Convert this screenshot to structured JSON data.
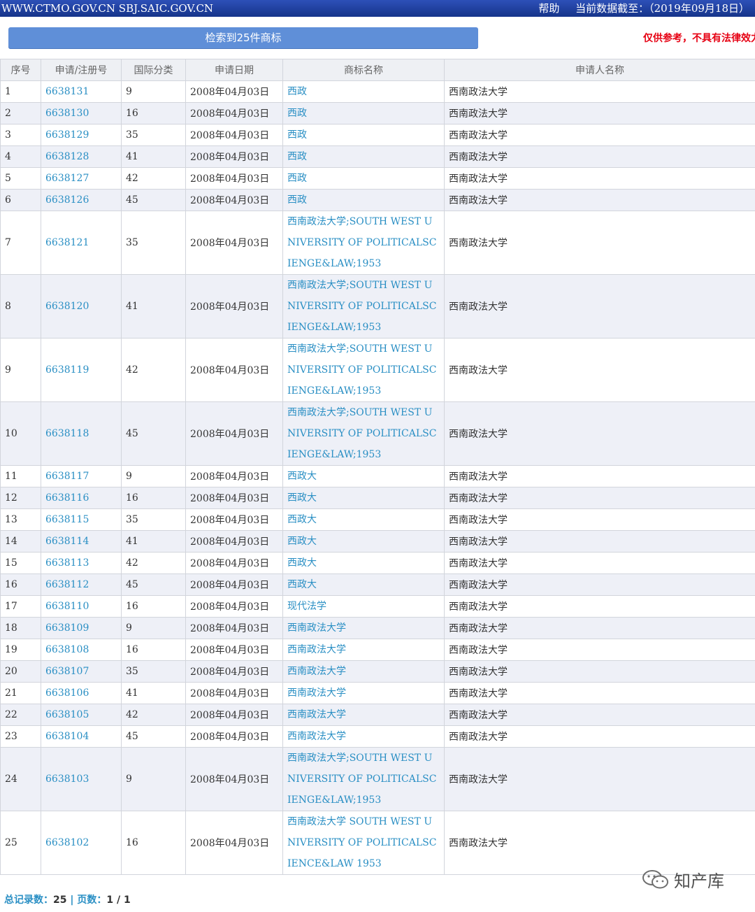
{
  "header": {
    "site": "WWW.CTMO.GOV.CN SBJ.SAIC.GOV.CN",
    "help": "帮助",
    "data_as_of": "当前数据截至：（2019年09月18日）"
  },
  "result_button": "检索到25件商标",
  "disclaimer": "仅供参考，不具有法律效力",
  "columns": [
    "序号",
    "申请/注册号",
    "国际分类",
    "申请日期",
    "商标名称",
    "申请人名称"
  ],
  "rows": [
    {
      "seq": "1",
      "reg": "6638131",
      "cls": "9",
      "date": "2008年04月03日",
      "name": "西政",
      "applicant": "西南政法大学"
    },
    {
      "seq": "2",
      "reg": "6638130",
      "cls": "16",
      "date": "2008年04月03日",
      "name": "西政",
      "applicant": "西南政法大学"
    },
    {
      "seq": "3",
      "reg": "6638129",
      "cls": "35",
      "date": "2008年04月03日",
      "name": "西政",
      "applicant": "西南政法大学"
    },
    {
      "seq": "4",
      "reg": "6638128",
      "cls": "41",
      "date": "2008年04月03日",
      "name": "西政",
      "applicant": "西南政法大学"
    },
    {
      "seq": "5",
      "reg": "6638127",
      "cls": "42",
      "date": "2008年04月03日",
      "name": "西政",
      "applicant": "西南政法大学"
    },
    {
      "seq": "6",
      "reg": "6638126",
      "cls": "45",
      "date": "2008年04月03日",
      "name": "西政",
      "applicant": "西南政法大学"
    },
    {
      "seq": "7",
      "reg": "6638121",
      "cls": "35",
      "date": "2008年04月03日",
      "name": "西南政法大学;SOUTH WEST UNIVERSITY OF POLITICALSCIENGE&LAW;1953",
      "applicant": "西南政法大学"
    },
    {
      "seq": "8",
      "reg": "6638120",
      "cls": "41",
      "date": "2008年04月03日",
      "name": "西南政法大学;SOUTH WEST UNIVERSITY OF POLITICALSCIENGE&LAW;1953",
      "applicant": "西南政法大学"
    },
    {
      "seq": "9",
      "reg": "6638119",
      "cls": "42",
      "date": "2008年04月03日",
      "name": "西南政法大学;SOUTH WEST UNIVERSITY OF POLITICALSCIENGE&LAW;1953",
      "applicant": "西南政法大学"
    },
    {
      "seq": "10",
      "reg": "6638118",
      "cls": "45",
      "date": "2008年04月03日",
      "name": "西南政法大学;SOUTH WEST UNIVERSITY OF POLITICALSCIENGE&LAW;1953",
      "applicant": "西南政法大学"
    },
    {
      "seq": "11",
      "reg": "6638117",
      "cls": "9",
      "date": "2008年04月03日",
      "name": "西政大",
      "applicant": "西南政法大学"
    },
    {
      "seq": "12",
      "reg": "6638116",
      "cls": "16",
      "date": "2008年04月03日",
      "name": "西政大",
      "applicant": "西南政法大学"
    },
    {
      "seq": "13",
      "reg": "6638115",
      "cls": "35",
      "date": "2008年04月03日",
      "name": "西政大",
      "applicant": "西南政法大学"
    },
    {
      "seq": "14",
      "reg": "6638114",
      "cls": "41",
      "date": "2008年04月03日",
      "name": "西政大",
      "applicant": "西南政法大学"
    },
    {
      "seq": "15",
      "reg": "6638113",
      "cls": "42",
      "date": "2008年04月03日",
      "name": "西政大",
      "applicant": "西南政法大学"
    },
    {
      "seq": "16",
      "reg": "6638112",
      "cls": "45",
      "date": "2008年04月03日",
      "name": "西政大",
      "applicant": "西南政法大学"
    },
    {
      "seq": "17",
      "reg": "6638110",
      "cls": "16",
      "date": "2008年04月03日",
      "name": "现代法学",
      "applicant": "西南政法大学"
    },
    {
      "seq": "18",
      "reg": "6638109",
      "cls": "9",
      "date": "2008年04月03日",
      "name": "西南政法大学",
      "applicant": "西南政法大学"
    },
    {
      "seq": "19",
      "reg": "6638108",
      "cls": "16",
      "date": "2008年04月03日",
      "name": "西南政法大学",
      "applicant": "西南政法大学"
    },
    {
      "seq": "20",
      "reg": "6638107",
      "cls": "35",
      "date": "2008年04月03日",
      "name": "西南政法大学",
      "applicant": "西南政法大学"
    },
    {
      "seq": "21",
      "reg": "6638106",
      "cls": "41",
      "date": "2008年04月03日",
      "name": "西南政法大学",
      "applicant": "西南政法大学"
    },
    {
      "seq": "22",
      "reg": "6638105",
      "cls": "42",
      "date": "2008年04月03日",
      "name": "西南政法大学",
      "applicant": "西南政法大学"
    },
    {
      "seq": "23",
      "reg": "6638104",
      "cls": "45",
      "date": "2008年04月03日",
      "name": "西南政法大学",
      "applicant": "西南政法大学"
    },
    {
      "seq": "24",
      "reg": "6638103",
      "cls": "9",
      "date": "2008年04月03日",
      "name": "西南政法大学;SOUTH WEST UNIVERSITY OF POLITICALSCIENGE&LAW;1953",
      "applicant": "西南政法大学"
    },
    {
      "seq": "25",
      "reg": "6638102",
      "cls": "16",
      "date": "2008年04月03日",
      "name": "西南政法大学 SOUTH WEST UNIVERSITY OF POLITICALSCIENCE&LAW 1953",
      "applicant": "西南政法大学"
    }
  ],
  "footer": {
    "total_label": "总记录数：",
    "total_value": "25",
    "separator": "|",
    "pages_label": "页数：",
    "pages_value": "1 / 1"
  },
  "watermark": "知产库",
  "colors": {
    "topbar": "#1f3f9a",
    "button": "#5f8fd8",
    "link": "#2a8fc4",
    "disclaimer": "#e60012",
    "row_alt": "#eef0f7"
  }
}
